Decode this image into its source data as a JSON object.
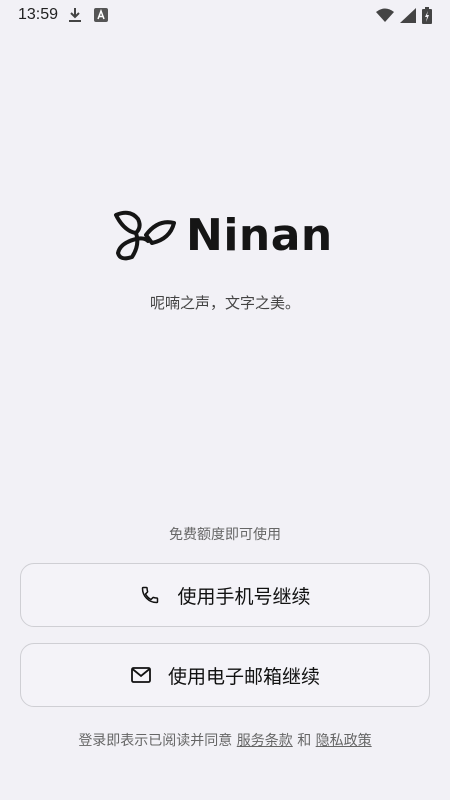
{
  "status_bar": {
    "time": "13:59",
    "icons": [
      "download-icon",
      "a-notification-icon",
      "wifi-icon",
      "signal-icon",
      "battery-icon"
    ]
  },
  "brand": {
    "name": "Ninan",
    "tagline": "呢喃之声，文字之美。"
  },
  "auth": {
    "free_note": "免费额度即可使用",
    "phone_button": "使用手机号继续",
    "email_button": "使用电子邮箱继续"
  },
  "terms": {
    "prefix": "登录即表示已阅读并同意",
    "service_link": "服务条款",
    "and": "和",
    "privacy_link": "隐私政策"
  },
  "colors": {
    "background": "#f2f1f6",
    "border": "#cfcfd4",
    "text": "#111111",
    "muted": "#666666"
  }
}
